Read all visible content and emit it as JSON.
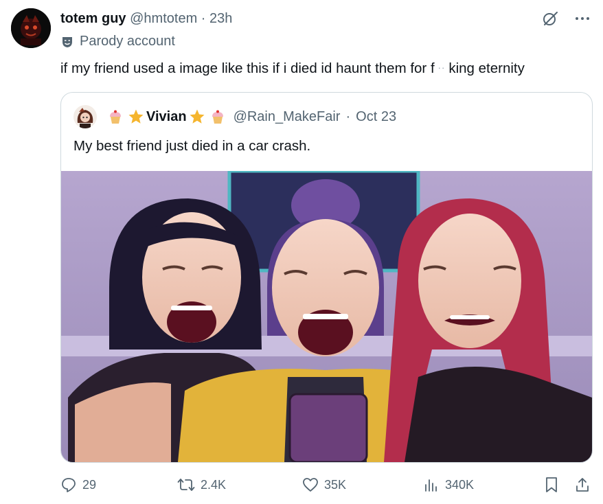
{
  "post": {
    "display_name": "totem guy",
    "handle": "@hmtotem",
    "separator": "·",
    "time": "23h",
    "parody_label": "Parody account",
    "text_part1": "if my friend used a image like this if i died id haunt them for f",
    "text_censor": "··",
    "text_part2": "king eternity"
  },
  "quote": {
    "display_name": "Vivian",
    "handle": "@Rain_MakeFair",
    "separator": "·",
    "date": "Oct 23",
    "text": "My best friend just died in a car crash.",
    "name_emojis": [
      "cupcake",
      "star",
      "star",
      "cupcake"
    ]
  },
  "actions": {
    "replies": "29",
    "reposts": "2.4K",
    "likes": "35K",
    "views": "340K"
  },
  "icons": [
    "grok-icon",
    "more-icon",
    "parody-mask-icon",
    "reply-icon",
    "repost-icon",
    "like-icon",
    "views-icon",
    "bookmark-icon",
    "share-icon"
  ],
  "colors": {
    "text_primary": "#0f1419",
    "text_secondary": "#536471",
    "border": "#cfd9de"
  }
}
